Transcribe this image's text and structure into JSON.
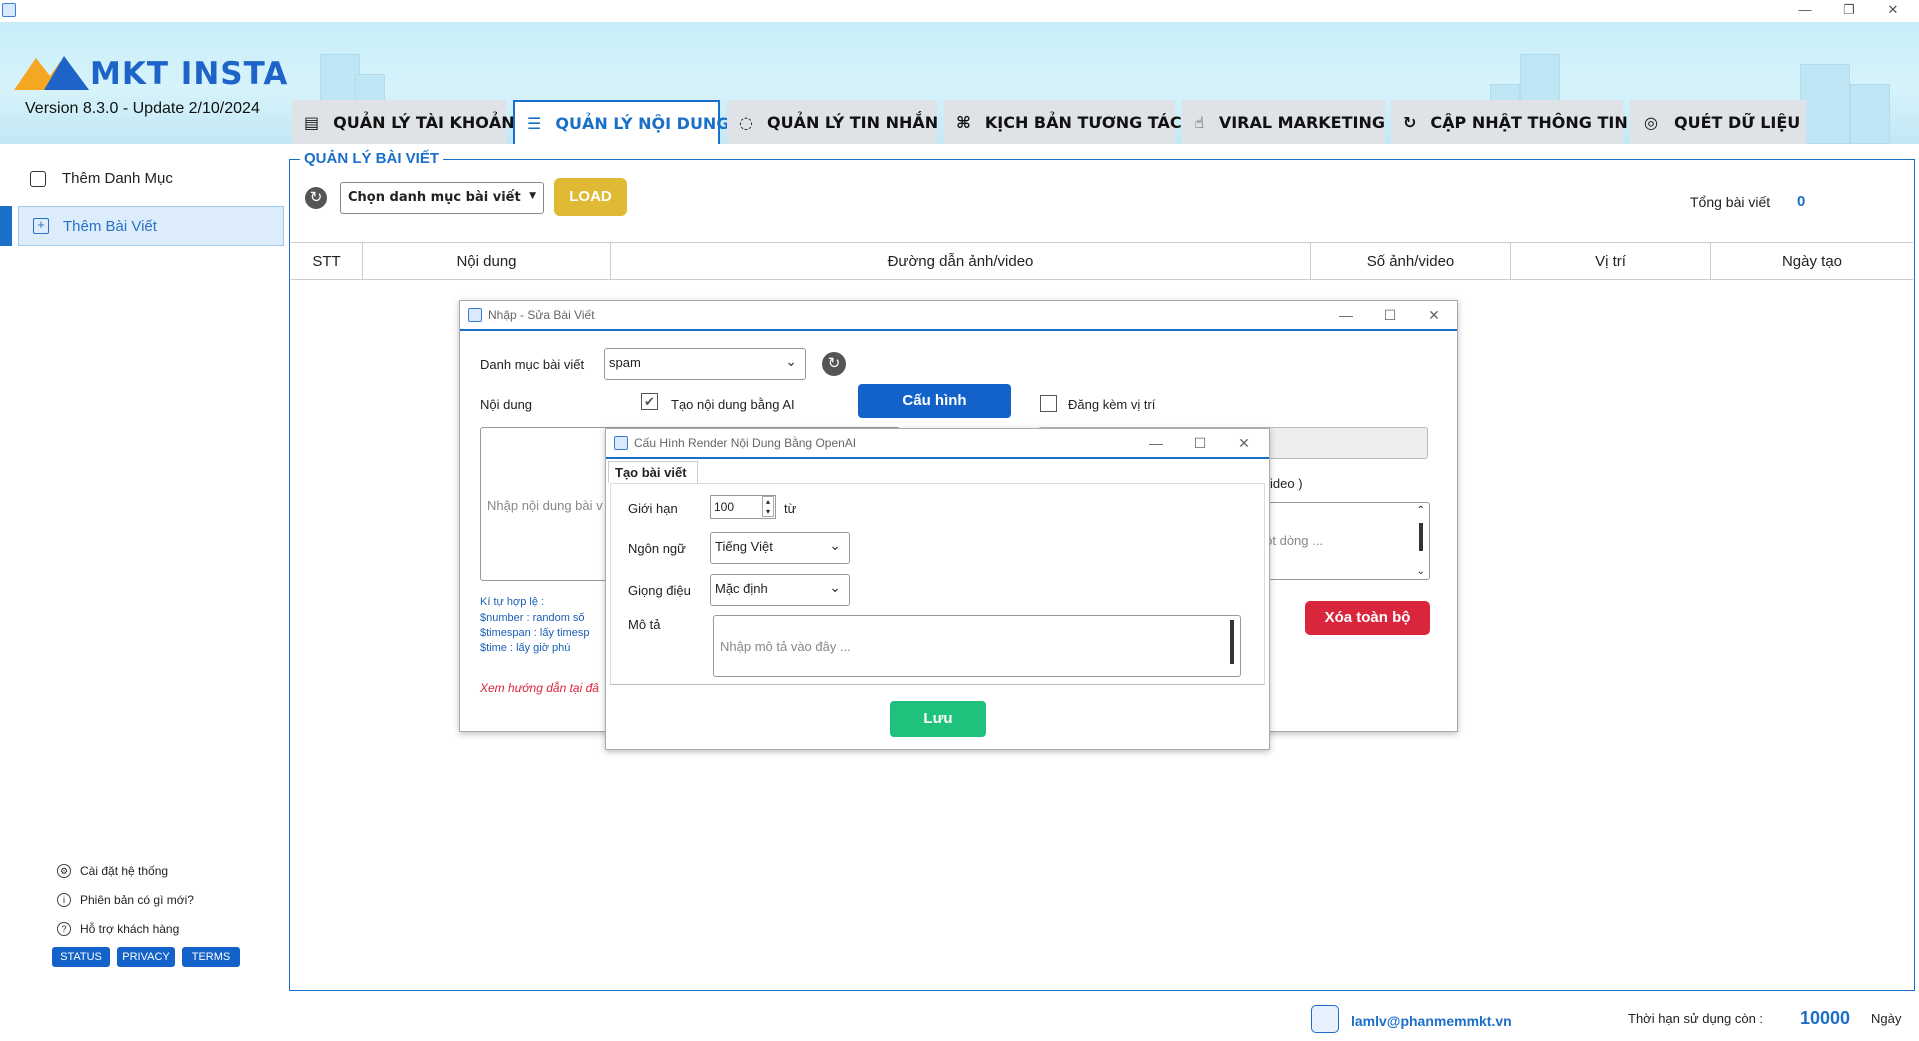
{
  "window": {
    "minimize": "—",
    "restore": "❐",
    "close": "✕"
  },
  "header": {
    "logo_text": "MKT INSTA",
    "version": "Version  8.3.0  - Update  2/10/2024"
  },
  "tabs": [
    {
      "label": "QUẢN LÝ TÀI KHOẢN",
      "icon": "list-icon"
    },
    {
      "label": "QUẢN LÝ NỘI DUNG",
      "icon": "content-list-icon"
    },
    {
      "label": "QUẢN LÝ TIN NHẮN",
      "icon": "chat-icon"
    },
    {
      "label": "KỊCH BẢN TƯƠNG TÁC",
      "icon": "grid-icon"
    },
    {
      "label": "VIRAL MARKETING",
      "icon": "hand-icon"
    },
    {
      "label": "CẬP NHẬT THÔNG TIN",
      "icon": "refresh-check-icon"
    },
    {
      "label": "QUÉT DỮ LIỆU",
      "icon": "radar-icon"
    }
  ],
  "sidebar": {
    "items": [
      {
        "label": "Thêm Danh Mục"
      },
      {
        "label": "Thêm Bài Viết"
      }
    ],
    "bottom": [
      {
        "label": "Cài đặt hệ thống"
      },
      {
        "label": "Phiên bản có gì mới?"
      },
      {
        "label": "Hỗ trợ khách hàng"
      }
    ],
    "badges": [
      "STATUS",
      "PRIVACY",
      "TERMS"
    ]
  },
  "main": {
    "section_title": "QUẢN LÝ BÀI VIẾT",
    "category_select": "Chọn danh mục bài viết",
    "load_button": "LOAD",
    "total_label": "Tổng bài viết",
    "total_value": "0",
    "columns": [
      "STT",
      "Nội dung",
      "Đường dẫn ảnh/video",
      "Số ảnh/video",
      "Vị trí",
      "Ngày tạo"
    ]
  },
  "dialog_edit": {
    "title": "Nhập - Sửa Bài Viết",
    "category_label": "Danh mục bài viết",
    "category_value": "spam",
    "content_label": "Nội dung",
    "ai_checkbox_label": "Tạo nội dung bằng AI",
    "config_button": "Cấu hình",
    "location_checkbox_label": "Đăng kèm vị trí",
    "content_placeholder": "Nhập nội dung bài v",
    "media_hint": "ideo )",
    "media_placeholder": "dẫn một dòng ...",
    "valid_chars_title": "Kí tự hợp lệ :",
    "rule_1": "$number    : random số",
    "rule_2": "$timespan  : lấy timesp",
    "rule_3": "$time        : lấy giờ phú",
    "guide_link": "Xem hướng dẫn tại đâ",
    "delete_all": "Xóa toàn bộ"
  },
  "dialog_ai": {
    "title": "Cấu Hình Render Nội Dung Bằng OpenAI",
    "tab": "Tạo bài viết",
    "limit_label": "Giới hạn",
    "limit_value": "100",
    "limit_unit": "từ",
    "language_label": "Ngôn ngữ",
    "language_value": "Tiếng Việt",
    "tone_label": "Giọng điệu",
    "tone_value": "Mặc định",
    "desc_label": "Mô tả",
    "desc_placeholder": "Nhập mô tả vào đây ...",
    "save_button": "Lưu"
  },
  "footer": {
    "email": "lamlv@phanmemmkt.vn",
    "expiry_label": "Thời hạn sử dụng còn :",
    "expiry_value": "10000",
    "expiry_unit": "Ngày"
  },
  "colors": {
    "accent": "#1a6fc9",
    "load": "#e0b935",
    "danger": "#d9263c",
    "save": "#1ec27a"
  }
}
